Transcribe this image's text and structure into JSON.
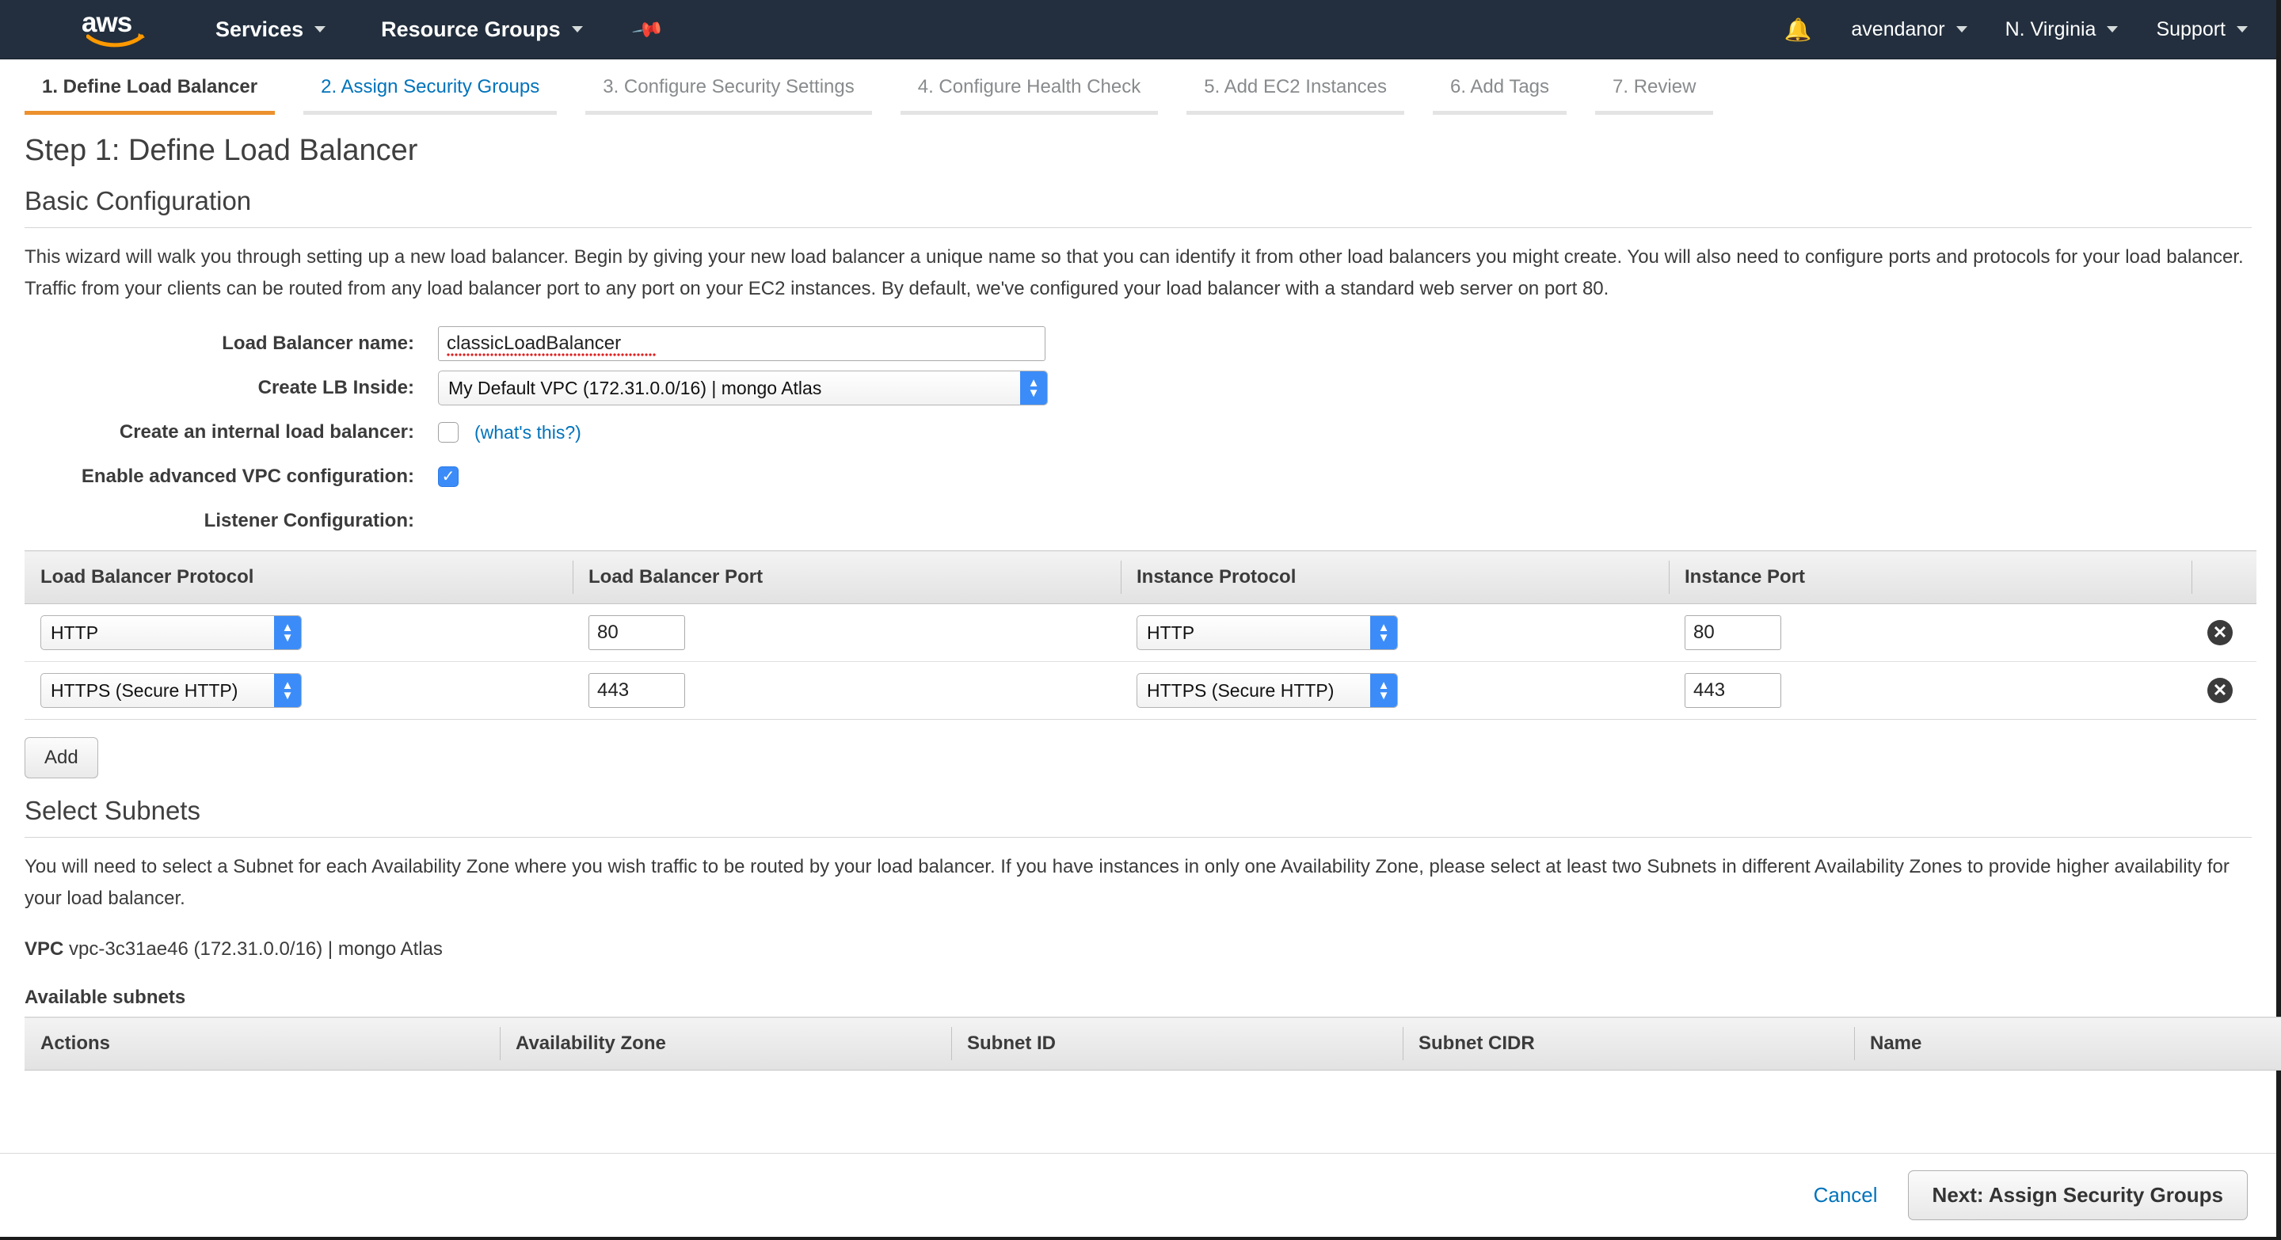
{
  "topnav": {
    "logo_text": "aws",
    "services_label": "Services",
    "resource_groups_label": "Resource Groups",
    "pin_icon": "pin-icon",
    "bell_icon": "bell-icon",
    "account_label": "avendanor",
    "region_label": "N. Virginia",
    "support_label": "Support",
    "bg_color": "#232f3e"
  },
  "wizard": {
    "tabs": [
      {
        "label": "1. Define Load Balancer",
        "state": "active"
      },
      {
        "label": "2. Assign Security Groups",
        "state": "link"
      },
      {
        "label": "3. Configure Security Settings",
        "state": "inactive"
      },
      {
        "label": "4. Configure Health Check",
        "state": "inactive"
      },
      {
        "label": "5. Add EC2 Instances",
        "state": "inactive"
      },
      {
        "label": "6. Add Tags",
        "state": "inactive"
      },
      {
        "label": "7. Review",
        "state": "inactive"
      }
    ],
    "active_underline_color": "#ec912d"
  },
  "page": {
    "step_title": "Step 1: Define Load Balancer",
    "basic_config_title": "Basic Configuration",
    "basic_config_desc": "This wizard will walk you through setting up a new load balancer. Begin by giving your new load balancer a unique name so that you can identify it from other load balancers you might create. You will also need to configure ports and protocols for your load balancer. Traffic from your clients can be routed from any load balancer port to any port on your EC2 instances. By default, we've configured your load balancer with a standard web server on port 80."
  },
  "form": {
    "lb_name_label": "Load Balancer name:",
    "lb_name_value": "classicLoadBalancer",
    "lb_name_placeholder": "",
    "create_lb_inside_label": "Create LB Inside:",
    "create_lb_inside_value": "My Default VPC (172.31.0.0/16) | mongo Atlas",
    "internal_lb_label": "Create an internal load balancer:",
    "internal_lb_checked": false,
    "whats_this_label": "(what's this?)",
    "advanced_vpc_label": "Enable advanced VPC configuration:",
    "advanced_vpc_checked": true,
    "advanced_vpc_check_glyph": "✓",
    "listener_config_label": "Listener Configuration:"
  },
  "listener_table": {
    "columns": [
      "Load Balancer Protocol",
      "Load Balancer Port",
      "Instance Protocol",
      "Instance Port",
      ""
    ],
    "rows": [
      {
        "lb_protocol": "HTTP",
        "lb_port": "80",
        "instance_protocol": "HTTP",
        "instance_port": "80",
        "delete_icon": "delete-circle-icon"
      },
      {
        "lb_protocol": "HTTPS (Secure HTTP)",
        "lb_port": "443",
        "instance_protocol": "HTTPS (Secure HTTP)",
        "instance_port": "443",
        "delete_icon": "delete-circle-icon"
      }
    ],
    "add_button_label": "Add"
  },
  "subnets": {
    "title": "Select Subnets",
    "desc": "You will need to select a Subnet for each Availability Zone where you wish traffic to be routed by your load balancer. If you have instances in only one Availability Zone, please select at least two Subnets in different Availability Zones to provide higher availability for your load balancer.",
    "vpc_label": "VPC",
    "vpc_value": "vpc-3c31ae46 (172.31.0.0/16) | mongo Atlas",
    "available_label": "Available subnets",
    "columns": [
      "Actions",
      "Availability Zone",
      "Subnet ID",
      "Subnet CIDR",
      "Name"
    ],
    "rows": []
  },
  "footer": {
    "cancel_label": "Cancel",
    "next_label": "Next: Assign Security Groups",
    "link_color": "#0073bb"
  }
}
